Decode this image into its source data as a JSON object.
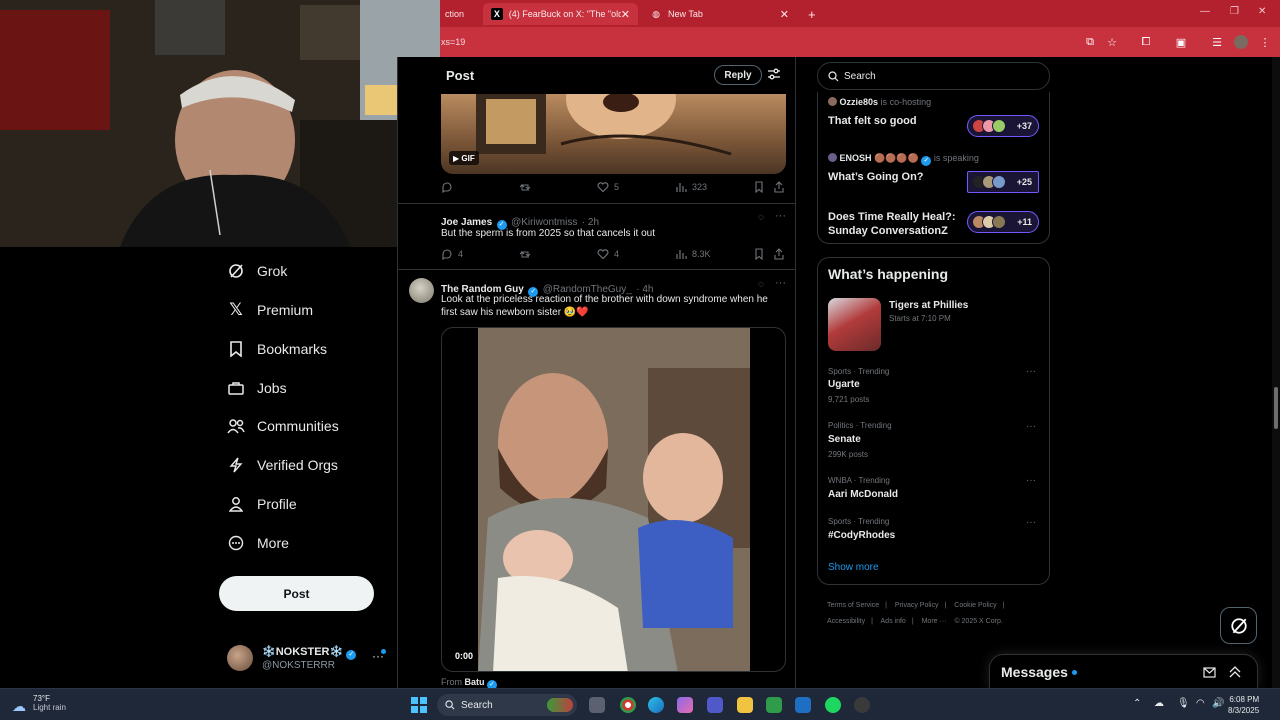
{
  "browser": {
    "tabs": [
      {
        "label": "ction",
        "active": false
      },
      {
        "label": "(4) FearBuck on X: \"The \"oldest",
        "active": true,
        "icon": "X"
      },
      {
        "label": "New Tab",
        "active": false
      }
    ],
    "address_fragment": "xs=19",
    "new_tab_symbol": "+"
  },
  "nav": {
    "items": [
      {
        "label": "Grok",
        "icon": "grok-icon"
      },
      {
        "label": "Premium",
        "icon": "x-logo-icon"
      },
      {
        "label": "Bookmarks",
        "icon": "bookmark-icon"
      },
      {
        "label": "Jobs",
        "icon": "briefcase-icon"
      },
      {
        "label": "Communities",
        "icon": "people-icon"
      },
      {
        "label": "Verified Orgs",
        "icon": "lightning-icon"
      },
      {
        "label": "Profile",
        "icon": "person-icon"
      },
      {
        "label": "More",
        "icon": "more-circle-icon"
      }
    ],
    "post_label": "Post",
    "account": {
      "name": "❄️NOKSTER❄️",
      "handle": "@NOKSTERRR",
      "more": "···"
    }
  },
  "center": {
    "header_title": "Post",
    "reply_label": "Reply",
    "gif_badge": "GIF",
    "first_actions": {
      "replies": "",
      "reposts": "",
      "likes": "5",
      "views": "323"
    },
    "tweets": [
      {
        "name": "Joe James",
        "handle": "@Kiriwontmiss",
        "time": "· 2h",
        "text": "But the sperm is from 2025 so that cancels it out",
        "replies": "4",
        "reposts": "",
        "likes": "4",
        "views": "8.3K"
      },
      {
        "name": "The Random Guy",
        "handle": "@RandomTheGuy_",
        "time": "· 4h",
        "text": "Look at the priceless reaction of the brother with down syndrome when he first saw his newborn sister 🥹❤️",
        "video_time": "0:00",
        "from_label": "From",
        "from_name": "Batu"
      }
    ]
  },
  "right": {
    "search_placeholder": "Search",
    "spaces": [
      {
        "host": "Ozzie80s",
        "status": "is co-hosting",
        "title": "That felt so good",
        "count": "+37"
      },
      {
        "host": "ENOSH 🟤🟤🟤🟤",
        "status": "is speaking",
        "title": "What’s Going On?",
        "count": "+25"
      },
      {
        "host": "",
        "status": "",
        "title": "Does Time Really Heal?: Sunday ConversationZ",
        "count": "+11"
      }
    ],
    "happening": {
      "title": "What’s happening",
      "event": {
        "title": "Tigers at Phillies",
        "subtitle": "Starts at 7:10 PM"
      },
      "trends": [
        {
          "category": "Sports · Trending",
          "name": "Ugarte",
          "posts": "9,721 posts"
        },
        {
          "category": "Politics · Trending",
          "name": "Senate",
          "posts": "299K posts"
        },
        {
          "category": "WNBA · Trending",
          "name": "Aari McDonald",
          "posts": ""
        },
        {
          "category": "Sports · Trending",
          "name": "#CodyRhodes",
          "posts": ""
        }
      ],
      "show_more": "Show more"
    },
    "footer": [
      "Terms of Service",
      "|",
      "Privacy Policy",
      "|",
      "Cookie Policy",
      "|",
      "Accessibility",
      "|",
      "Ads info",
      "|",
      "More ···",
      "© 2025 X Corp."
    ],
    "messages_title": "Messages"
  },
  "taskbar": {
    "weather_temp": "73°F",
    "weather_cond": "Light rain",
    "search_label": "Search",
    "time": "6:08 PM",
    "date": "8/3/2025"
  },
  "colors": {
    "accent": "#1d9bf0",
    "spaces_purple": "#7856ff",
    "chrome_red": "#c8323f"
  }
}
